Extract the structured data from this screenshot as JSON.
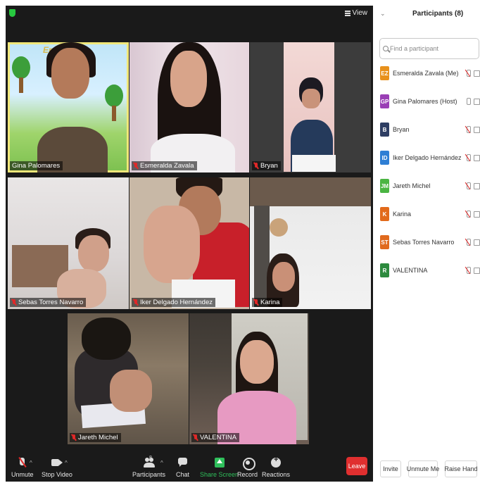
{
  "topbar": {
    "view_label": "View",
    "security_icon": "shield-icon"
  },
  "tiles": [
    {
      "name": "Gina Palomares",
      "muted": false,
      "active": true,
      "sign_text": "Eres"
    },
    {
      "name": "Esmeralda Zavala",
      "muted": true
    },
    {
      "name": "Bryan",
      "muted": true
    },
    {
      "name": "Sebas  Torres Navarro",
      "muted": true
    },
    {
      "name": "Iker Delgado Hernández",
      "muted": true
    },
    {
      "name": "Karina",
      "muted": true
    },
    {
      "name": "Jareth Michel",
      "muted": true
    },
    {
      "name": "VALENTINA",
      "muted": true
    }
  ],
  "toolbar": {
    "unmute": "Unmute",
    "stop_video": "Stop Video",
    "participants": "Participants",
    "participants_count": "8",
    "chat": "Chat",
    "share_screen": "Share Screen",
    "record": "Record",
    "reactions": "Reactions",
    "leave": "Leave",
    "share_color": "#2fbf5b",
    "leave_color": "#e02f2f"
  },
  "panel": {
    "title": "Participants (8)",
    "search_placeholder": "Find a participant",
    "participants": [
      {
        "initials": "EZ",
        "name": "Esmeralda Zavala (Me)",
        "color": "#e8911c",
        "muted": true
      },
      {
        "initials": "GP",
        "name": "Gina Palomares (Host)",
        "color": "#9a3fb5",
        "muted": false
      },
      {
        "initials": "B",
        "name": "Bryan",
        "color": "#2e3e63",
        "muted": true
      },
      {
        "initials": "ID",
        "name": "Iker Delgado Hernández",
        "color": "#2f7fd4",
        "muted": true
      },
      {
        "initials": "JM",
        "name": "Jareth Michel",
        "color": "#4bb543",
        "muted": true
      },
      {
        "initials": "K",
        "name": "Karina",
        "color": "#e26a1b",
        "muted": true
      },
      {
        "initials": "ST",
        "name": "Sebas  Torres Navarro",
        "color": "#e06a1e",
        "muted": true
      },
      {
        "initials": "R",
        "name": "VALENTINA",
        "color": "#2d8a3e",
        "muted": true
      }
    ],
    "invite": "Invite",
    "unmute_me": "Unmute Me",
    "raise_hand": "Raise Hand"
  }
}
